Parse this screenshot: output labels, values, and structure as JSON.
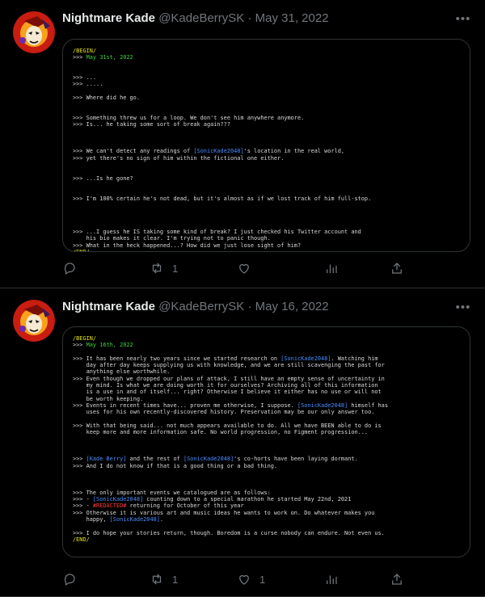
{
  "tweets": [
    {
      "name": "Nightmare Kade",
      "handle": "@KadeBerrySK",
      "separator": "·",
      "date": "May 31, 2022",
      "retweets": "1",
      "likes": "",
      "log": [
        [
          [
            "tag",
            "/BEGIN/"
          ]
        ],
        [
          [
            "",
            ">>> "
          ],
          [
            "date",
            "May 31st, 2022"
          ]
        ],
        [
          [
            "",
            ""
          ]
        ],
        [
          [
            "",
            ""
          ]
        ],
        [
          [
            "",
            ">>> ..."
          ]
        ],
        [
          [
            "",
            ">>> ....."
          ]
        ],
        [
          [
            "",
            ""
          ]
        ],
        [
          [
            "",
            ">>> Where did he go."
          ]
        ],
        [
          [
            "",
            ""
          ]
        ],
        [
          [
            "",
            ""
          ]
        ],
        [
          [
            "",
            ">>> Something threw us for a loop. We don't see him anywhere anymore."
          ]
        ],
        [
          [
            "",
            ">>> Is... he taking some sort of break again???"
          ]
        ],
        [
          [
            "",
            ""
          ]
        ],
        [
          [
            "",
            ""
          ]
        ],
        [
          [
            "",
            ""
          ]
        ],
        [
          [
            "",
            ">>> We can't detect any readings of "
          ],
          [
            "link",
            "[SonicKade2048]"
          ],
          [
            "",
            "'s location in the real world,"
          ]
        ],
        [
          [
            "",
            ">>> yet there's no sign of him within the fictional one either."
          ]
        ],
        [
          [
            "",
            ""
          ]
        ],
        [
          [
            "",
            ""
          ]
        ],
        [
          [
            "",
            ">>> ...Is he gone?"
          ]
        ],
        [
          [
            "",
            ""
          ]
        ],
        [
          [
            "",
            ""
          ]
        ],
        [
          [
            "",
            ">>> I'm 100% certain he's not dead, but it's almost as if we lost track of him full-stop."
          ]
        ],
        [
          [
            "",
            ""
          ]
        ],
        [
          [
            "",
            ""
          ]
        ],
        [
          [
            "",
            ""
          ]
        ],
        [
          [
            "",
            ""
          ]
        ],
        [
          [
            "",
            ">>> ...I guess he IS taking some kind of break? I just checked his Twitter account and"
          ]
        ],
        [
          [
            "",
            "    his bio makes it clear. I'm trying not to panic though."
          ]
        ],
        [
          [
            "",
            ">>> What in the heck happened...? How did we just lose sight of him?"
          ]
        ],
        [
          [
            "tag",
            "/END/"
          ]
        ]
      ]
    },
    {
      "name": "Nightmare Kade",
      "handle": "@KadeBerrySK",
      "separator": "·",
      "date": "May 16, 2022",
      "retweets": "1",
      "likes": "1",
      "log": [
        [
          [
            "tag",
            "/BEGIN/"
          ]
        ],
        [
          [
            "",
            ">>> "
          ],
          [
            "date",
            "May 16th, 2022"
          ]
        ],
        [
          [
            "",
            ""
          ]
        ],
        [
          [
            "",
            ">>> It has been nearly two years since we started research on "
          ],
          [
            "link",
            "[SonicKade2048]"
          ],
          [
            "",
            ". Watching him"
          ]
        ],
        [
          [
            "",
            "    day after day keeps supplying us with knowledge, and we are still scavenging the past for"
          ]
        ],
        [
          [
            "",
            "    anything else worthwhile."
          ]
        ],
        [
          [
            "",
            ">>> Even though we dropped our plans of attack, I still have an empty sense of uncertainty in"
          ]
        ],
        [
          [
            "",
            "    my mind. Is what we are doing worth it for ourselves? Archiving all of this information"
          ]
        ],
        [
          [
            "",
            "    is a use in and of itself... right? Otherwise I believe it either has no use or will not"
          ]
        ],
        [
          [
            "",
            "    be worth keeping."
          ]
        ],
        [
          [
            "",
            ">>> Events in recent times have... proven me otherwise, I suppose. "
          ],
          [
            "link",
            "[SonicKade2048]"
          ],
          [
            "",
            " himself has"
          ]
        ],
        [
          [
            "",
            "    uses for his own recently-discovered history. Preservation may be our only answer too."
          ]
        ],
        [
          [
            "",
            ""
          ]
        ],
        [
          [
            "",
            ">>> With that being said... not much appears available to do. All we have BEEN able to do is"
          ]
        ],
        [
          [
            "",
            "    keep more and more information safe. No world progression, no Figment progression..."
          ]
        ],
        [
          [
            "",
            ""
          ]
        ],
        [
          [
            "",
            ""
          ]
        ],
        [
          [
            "",
            ""
          ]
        ],
        [
          [
            "",
            ">>> "
          ],
          [
            "link",
            "[Kade Berry]"
          ],
          [
            "",
            " and the rest of "
          ],
          [
            "link",
            "[SonicKade2048]"
          ],
          [
            "",
            "'s co-horts have been laying dormant."
          ]
        ],
        [
          [
            "",
            ">>> And I do not know if that is a good thing or a bad thing."
          ]
        ],
        [
          [
            "",
            ""
          ]
        ],
        [
          [
            "",
            ""
          ]
        ],
        [
          [
            "",
            ""
          ]
        ],
        [
          [
            "",
            ">>> The only important events we catalogued are as follows:"
          ]
        ],
        [
          [
            "",
            ">>> - "
          ],
          [
            "link",
            "[SonicKade2048]"
          ],
          [
            "",
            " counting down to a special marathon he started May 22nd, 2021"
          ]
        ],
        [
          [
            "",
            ">>> - "
          ],
          [
            "red",
            "#REDACTED#"
          ],
          [
            "",
            " returning for October of this year"
          ]
        ],
        [
          [
            "",
            ">>> Otherwise it is various art and music ideas he wants to work on. Do whatever makes you"
          ]
        ],
        [
          [
            "",
            "    happy, "
          ],
          [
            "link",
            "[SonicKade2048]"
          ],
          [
            "",
            "."
          ]
        ],
        [
          [
            "",
            ""
          ]
        ],
        [
          [
            "",
            ">>> I do hope your stories return, though. Boredom is a curse nobody can endure. Not even us."
          ]
        ],
        [
          [
            "tag",
            "/END/"
          ]
        ]
      ]
    }
  ]
}
